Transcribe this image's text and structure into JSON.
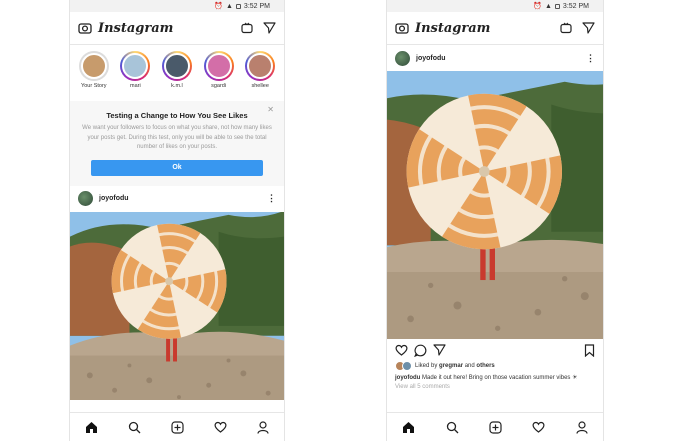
{
  "status": {
    "time": "3:52 PM"
  },
  "app": {
    "name": "Instagram"
  },
  "stories": [
    {
      "label": "Your Story",
      "own": true
    },
    {
      "label": "mari",
      "own": false
    },
    {
      "label": "k.m.l",
      "own": false
    },
    {
      "label": "sgardi",
      "own": false
    },
    {
      "label": "shellee",
      "own": false
    }
  ],
  "notice": {
    "title": "Testing a Change to How You See Likes",
    "body": "We want your followers to focus on what you share, not how many likes your posts get. During this test, only you will be able to see the total number of likes on your posts.",
    "ok_label": "Ok"
  },
  "post": {
    "username": "joyofodu",
    "liked_by_prefix": "Liked by",
    "liked_by_user": "gregmar",
    "liked_by_and": "and",
    "liked_by_others": "others",
    "caption": "Made it out here! Bring on those vacation summer vibes",
    "caption_emoji": "☀",
    "view_comments": "View all 5 comments"
  },
  "colors": {
    "accent": "#3897f0",
    "umbrella_orange": "#e8a25c"
  }
}
